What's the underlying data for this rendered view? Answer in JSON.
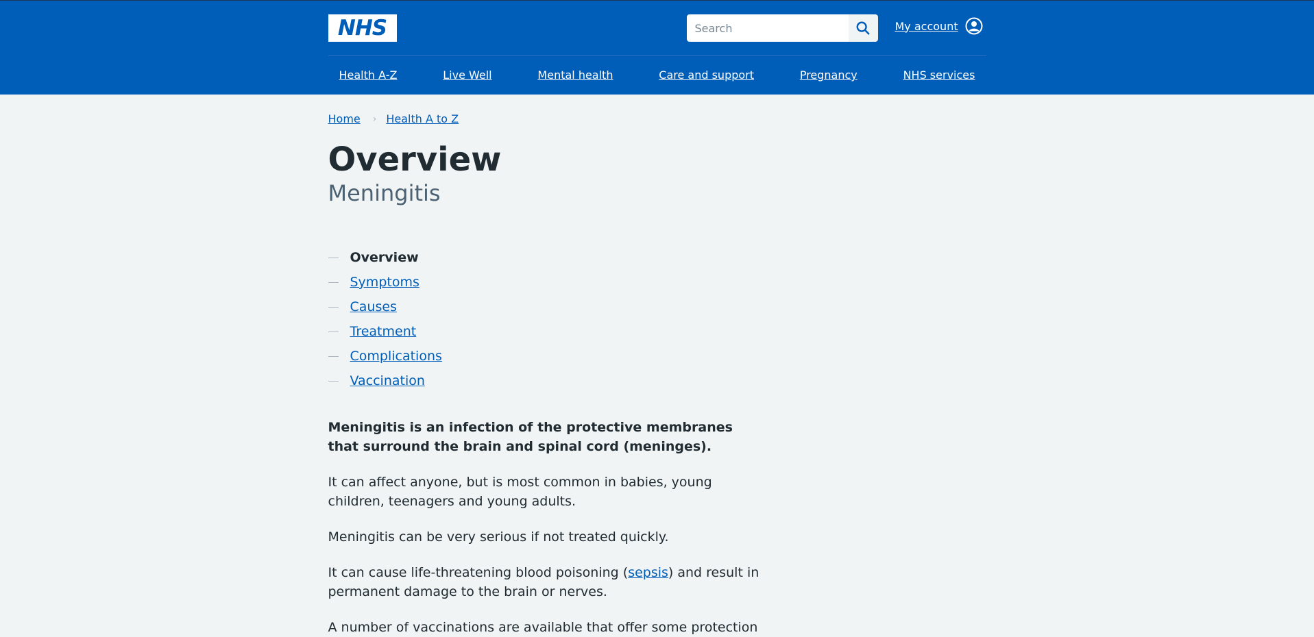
{
  "header": {
    "logo_text": "NHS",
    "search_placeholder": "Search",
    "account_label": "My account",
    "nav": [
      "Health A-Z",
      "Live Well",
      "Mental health",
      "Care and support",
      "Pregnancy",
      "NHS services"
    ]
  },
  "breadcrumb": [
    "Home",
    "Health A to Z"
  ],
  "page": {
    "title": "Overview",
    "caption": "Meningitis"
  },
  "contents": [
    "Overview",
    "Symptoms",
    "Causes",
    "Treatment",
    "Complications",
    "Vaccination"
  ],
  "body": {
    "lede": "Meningitis is an infection of the protective membranes that surround the brain and spinal cord (meninges).",
    "p1": "It can affect anyone, but is most common in babies, young children, teenagers and young adults.",
    "p2": "Meningitis can be very serious if not treated quickly.",
    "p3_before": "It can cause life-threatening blood poisoning (",
    "p3_link": "sepsis",
    "p3_after": ") and result in permanent damage to the brain or nerves.",
    "p4": "A number of vaccinations are available that offer some protection"
  },
  "colors": {
    "brand": "#005eb8",
    "background": "#f0f4f5",
    "text": "#212b32"
  }
}
